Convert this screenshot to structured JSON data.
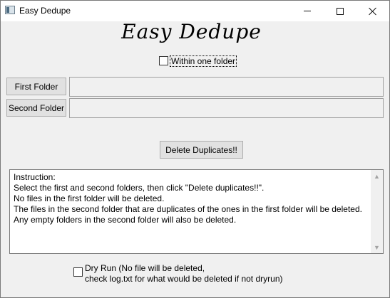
{
  "window": {
    "title": "Easy Dedupe"
  },
  "app": {
    "title": "Easy Dedupe"
  },
  "options": {
    "within_one_folder": {
      "label": "Within one folder",
      "checked": false
    }
  },
  "folders": {
    "first_button": "First Folder",
    "first_value": "",
    "second_button": "Second Folder",
    "second_value": ""
  },
  "actions": {
    "delete_label": "Delete Duplicates!!"
  },
  "instructions": {
    "lines": [
      "Instruction:",
      "Select the first and second folders, then click \"Delete duplicates!!\".",
      "No files in the first folder will be deleted.",
      "The files in the second folder that are duplicates of the ones in the first folder will be deleted.",
      "Any empty folders in the second folder will also be deleted."
    ]
  },
  "dry_run": {
    "line1": "Dry Run (No file will be deleted,",
    "line2": "check log.txt for what would be deleted if not dryrun)",
    "checked": false
  },
  "icons": {
    "app": "app-window-icon",
    "minimize": "minimize-icon",
    "maximize": "maximize-icon",
    "close": "close-icon",
    "scroll_up": "scroll-up-arrow-icon",
    "scroll_down": "scroll-down-arrow-icon"
  }
}
